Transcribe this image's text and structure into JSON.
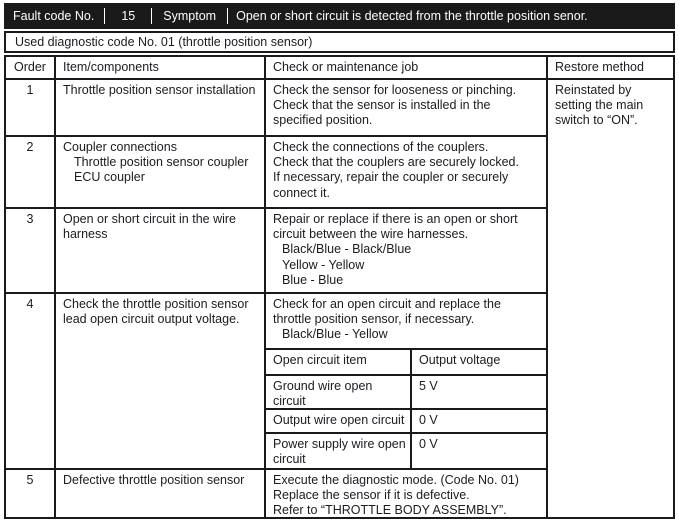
{
  "fault_bar": {
    "fault_code_label": "Fault code No.",
    "fault_code_value": "15",
    "symptom_label": "Symptom",
    "symptom_text": "Open or short circuit is detected from the throttle position senor."
  },
  "used_code_row": {
    "text": "Used diagnostic code No. 01 (throttle position sensor)"
  },
  "table": {
    "headers": {
      "order": "Order",
      "item": "Item/components",
      "check": "Check or maintenance job",
      "restore": "Restore method"
    },
    "restore_method_text": "Reinstated by setting the main switch to “ON”.",
    "rows": [
      {
        "order": "1",
        "item_lines": [
          "Throttle position sensor installation"
        ],
        "check_lines": [
          "Check the sensor for looseness or pinching.",
          "Check that the sensor is installed in the specified position."
        ]
      },
      {
        "order": "2",
        "item_lines": [
          "Coupler connections"
        ],
        "item_sub_lines": [
          "Throttle position sensor coupler",
          "ECU coupler"
        ],
        "check_lines": [
          "Check the connections of the couplers.",
          "Check that the couplers are securely locked.",
          "If necessary, repair the coupler or securely connect it."
        ]
      },
      {
        "order": "3",
        "item_lines": [
          "Open or short circuit in the wire harness"
        ],
        "check_lines": [
          "Repair or replace if there is an open or short circuit between the wire harnesses."
        ],
        "check_sub_lines": [
          "Black/Blue - Black/Blue",
          "Yellow - Yellow",
          "Blue - Blue"
        ]
      },
      {
        "order": "4",
        "item_lines": [
          "Check the throttle position sensor lead open circuit output voltage."
        ],
        "check_lines": [
          "Check for an open circuit and replace the throttle position sensor, if necessary."
        ],
        "check_sub_lines": [
          "Black/Blue - Yellow"
        ],
        "subtable": {
          "headers": [
            "Open circuit item",
            "Output voltage"
          ],
          "rows": [
            {
              "item": "Ground wire open circuit",
              "voltage": "5 V"
            },
            {
              "item": "Output wire open circuit",
              "voltage": "0 V"
            },
            {
              "item": "Power supply wire open circuit",
              "voltage": "0 V"
            }
          ]
        }
      },
      {
        "order": "5",
        "item_lines": [
          "Defective throttle position sensor"
        ],
        "check_lines": [
          "Execute the diagnostic mode. (Code No. 01)",
          "Replace the sensor if it is defective.",
          "Refer to “THROTTLE BODY ASSEMBLY”."
        ]
      }
    ]
  }
}
